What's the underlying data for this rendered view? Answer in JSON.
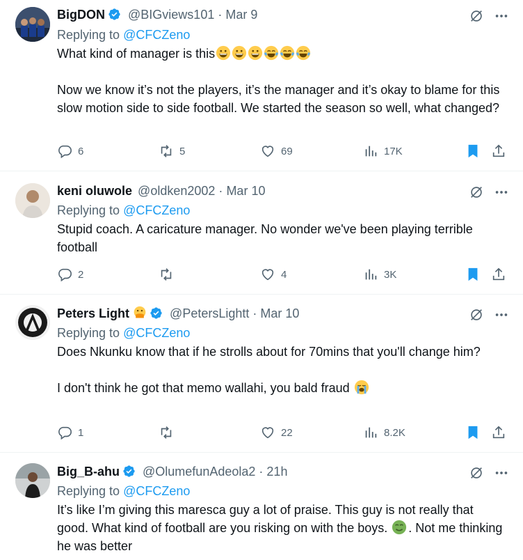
{
  "colors": {
    "accent": "#1d9bf0",
    "muted": "#536471",
    "text": "#0f1419",
    "divider": "#eff3f4",
    "bookmark": "#1d9bf0"
  },
  "tweets": [
    {
      "name": "BigDON",
      "verified": true,
      "handle": "@BIGviews101",
      "sep": "·",
      "date": "Mar 9",
      "replying_prefix": "Replying to ",
      "replying_to": "@CFCZeno",
      "paragraphs": [
        "What kind of manager is this",
        "Now we know it’s not the players, it’s the manager and it’s okay to blame for this slow motion side to side football. We started the season so well, what changed?"
      ],
      "emojis": [
        "grinning",
        "grinning",
        "grinning",
        "joy",
        "joy",
        "joy"
      ],
      "replies": "6",
      "retweets": "5",
      "likes": "69",
      "views": "17K",
      "bookmarked": true
    },
    {
      "name": "keni oluwole",
      "verified": false,
      "handle": "@oldken2002",
      "sep": "·",
      "date": "Mar 10",
      "replying_prefix": "Replying to ",
      "replying_to": "@CFCZeno",
      "paragraphs": [
        "Stupid coach. A caricature manager. No wonder we've been playing terrible football"
      ],
      "replies": "2",
      "retweets": "",
      "likes": "4",
      "views": "3K",
      "bookmarked": true
    },
    {
      "name": "Peters Light",
      "verified": true,
      "handle": "@PetersLightt",
      "sep": "·",
      "date": "Mar 10",
      "header_emoji": "face-with-hand-over-mouth",
      "replying_prefix": "Replying to ",
      "replying_to": "@CFCZeno",
      "paragraphs": [
        "Does Nkunku know that if he strolls about for 70mins that you'll change him?",
        "I don't think he got that memo wallahi, you bald fraud"
      ],
      "emojis": [
        "loudly-crying"
      ],
      "replies": "1",
      "retweets": "",
      "likes": "22",
      "views": "8.2K",
      "bookmarked": true
    },
    {
      "name": "Big_B-ahu",
      "verified": true,
      "handle": "@OlumefunAdeola2",
      "sep": "·",
      "date": "21h",
      "replying_prefix": "Replying to ",
      "replying_to": "@CFCZeno",
      "paragraphs": [
        "It’s like I’m giving this maresca guy a lot of praise. This guy is not really that good. What kind of football are you risking on with the boys. ",
        "Not me thinking he was better"
      ],
      "emojis": [
        "nauseated"
      ]
    }
  ]
}
